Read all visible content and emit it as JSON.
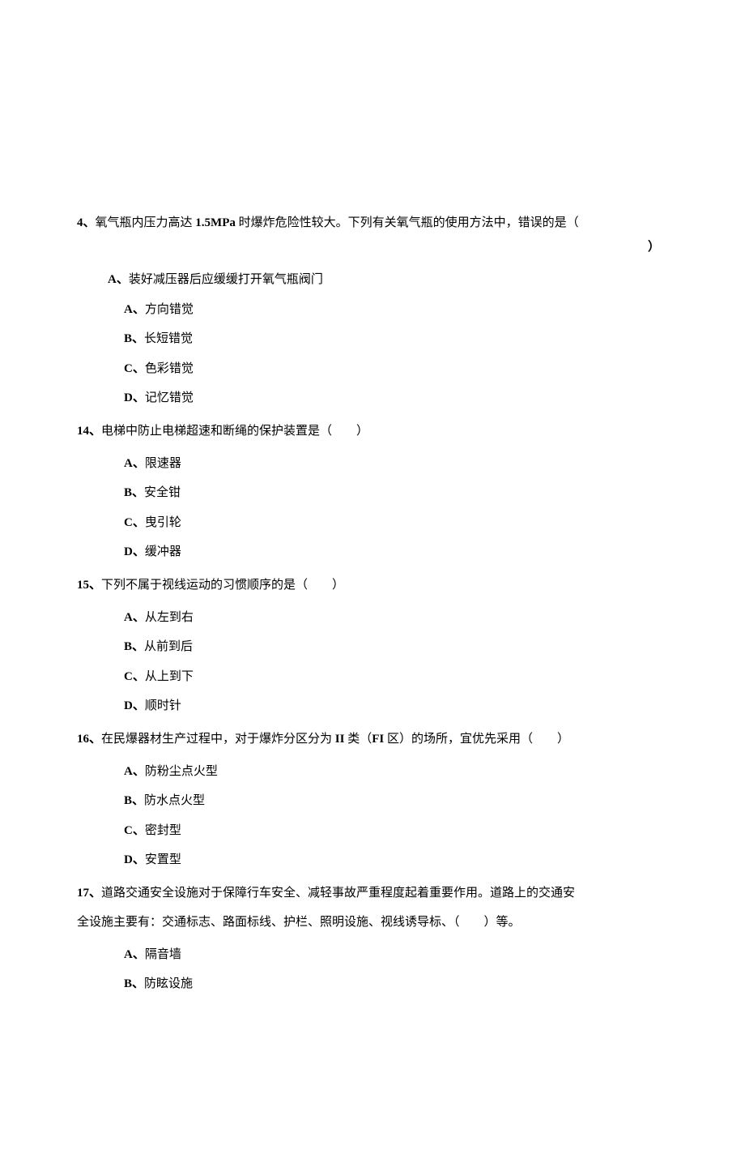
{
  "q4": {
    "num": "4、",
    "text_pre": "氧气瓶内压力高达 ",
    "mpa": "1.5MPa",
    "text_post": " 时爆炸危险性较大。下列有关氧气瓶的使用方法中，错误的是（",
    "close": "）",
    "optA_letter": "A、",
    "optA_text": "装好减压器后应缓缓打开氧气瓶阀门",
    "subA_letter": "A、",
    "subA_text": "方向错觉",
    "subB_letter": "B、",
    "subB_text": "长短错觉",
    "subC_letter": "C、",
    "subC_text": "色彩错觉",
    "subD_letter": "D、",
    "subD_text": "记忆错觉"
  },
  "q14": {
    "num": "14、",
    "text": "电梯中防止电梯超速和断绳的保护装置是（　　）",
    "A_letter": "A、",
    "A_text": "限速器",
    "B_letter": "B、",
    "B_text": "安全钳",
    "C_letter": "C、",
    "C_text": "曳引轮",
    "D_letter": "D、",
    "D_text": "缓冲器"
  },
  "q15": {
    "num": "15、",
    "text": "下列不属于视线运动的习惯顺序的是（　　）",
    "A_letter": "A、",
    "A_text": "从左到右",
    "B_letter": "B、",
    "B_text": "从前到后",
    "C_letter": "C、",
    "C_text": "从上到下",
    "D_letter": "D、",
    "D_text": "顺时针"
  },
  "q16": {
    "num": "16、",
    "text_pre": "在民爆器材生产过程中，对于爆炸分区分为 ",
    "cls": "II",
    "text_mid": " 类（",
    "fl": "FI",
    "text_post": " 区）的场所，宜优先采用（　　）",
    "A_letter": "A、",
    "A_text": "防粉尘点火型",
    "B_letter": "B、",
    "B_text": "防水点火型",
    "C_letter": "C、",
    "C_text": "密封型",
    "D_letter": "D、",
    "D_text": "安置型"
  },
  "q17": {
    "num": "17、",
    "line1": "道路交通安全设施对于保障行车安全、减轻事故严重程度起着重要作用。道路上的交通安",
    "line2": "全设施主要有：交通标志、路面标线、护栏、照明设施、视线诱导标、（　　）等。",
    "A_letter": "A、",
    "A_text": "隔音墙",
    "B_letter": "B、",
    "B_text": "防眩设施"
  }
}
